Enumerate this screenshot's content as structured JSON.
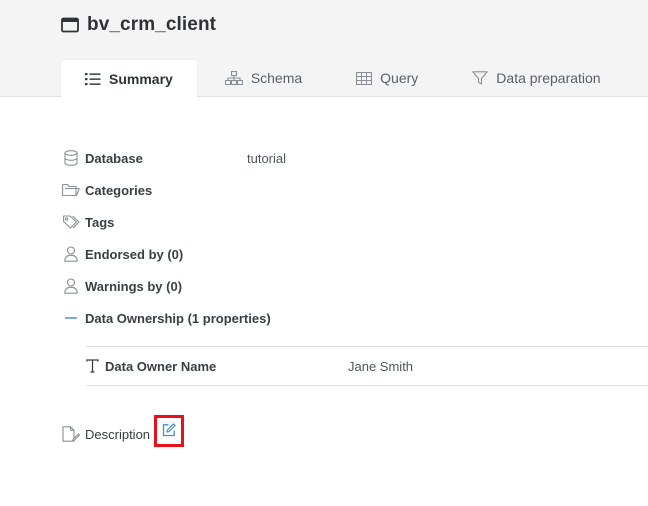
{
  "dataset": {
    "title": "bv_crm_client"
  },
  "tabs": [
    {
      "label": "Summary",
      "icon": "list-icon",
      "active": true
    },
    {
      "label": "Schema",
      "icon": "hierarchy-icon",
      "active": false
    },
    {
      "label": "Query",
      "icon": "table-grid-icon",
      "active": false
    },
    {
      "label": "Data preparation",
      "icon": "filter-icon",
      "active": false
    }
  ],
  "properties": {
    "database": {
      "label": "Database",
      "value": "tutorial",
      "icon": "database-icon"
    },
    "categories": {
      "label": "Categories",
      "icon": "folder-icon"
    },
    "tags": {
      "label": "Tags",
      "icon": "tag-icon"
    },
    "endorsed": {
      "label": "Endorsed by (0)",
      "icon": "user-icon"
    },
    "warnings": {
      "label": "Warnings by (0)",
      "icon": "user-icon"
    },
    "ownership": {
      "label": "Data Ownership (1 properties)",
      "icon": "collapse-minus-icon"
    }
  },
  "ownership_table": {
    "rows": [
      {
        "label": "Data Owner Name",
        "value": "Jane Smith",
        "icon": "text-type-icon"
      }
    ]
  },
  "description": {
    "label": "Description",
    "icon": "document-edit-icon",
    "edit_icon": "edit-icon",
    "highlight_color": "#e8101a"
  },
  "colors": {
    "accent": "#4a90c8",
    "header_bg": "#f4f4f5",
    "highlight": "#e8101a"
  }
}
